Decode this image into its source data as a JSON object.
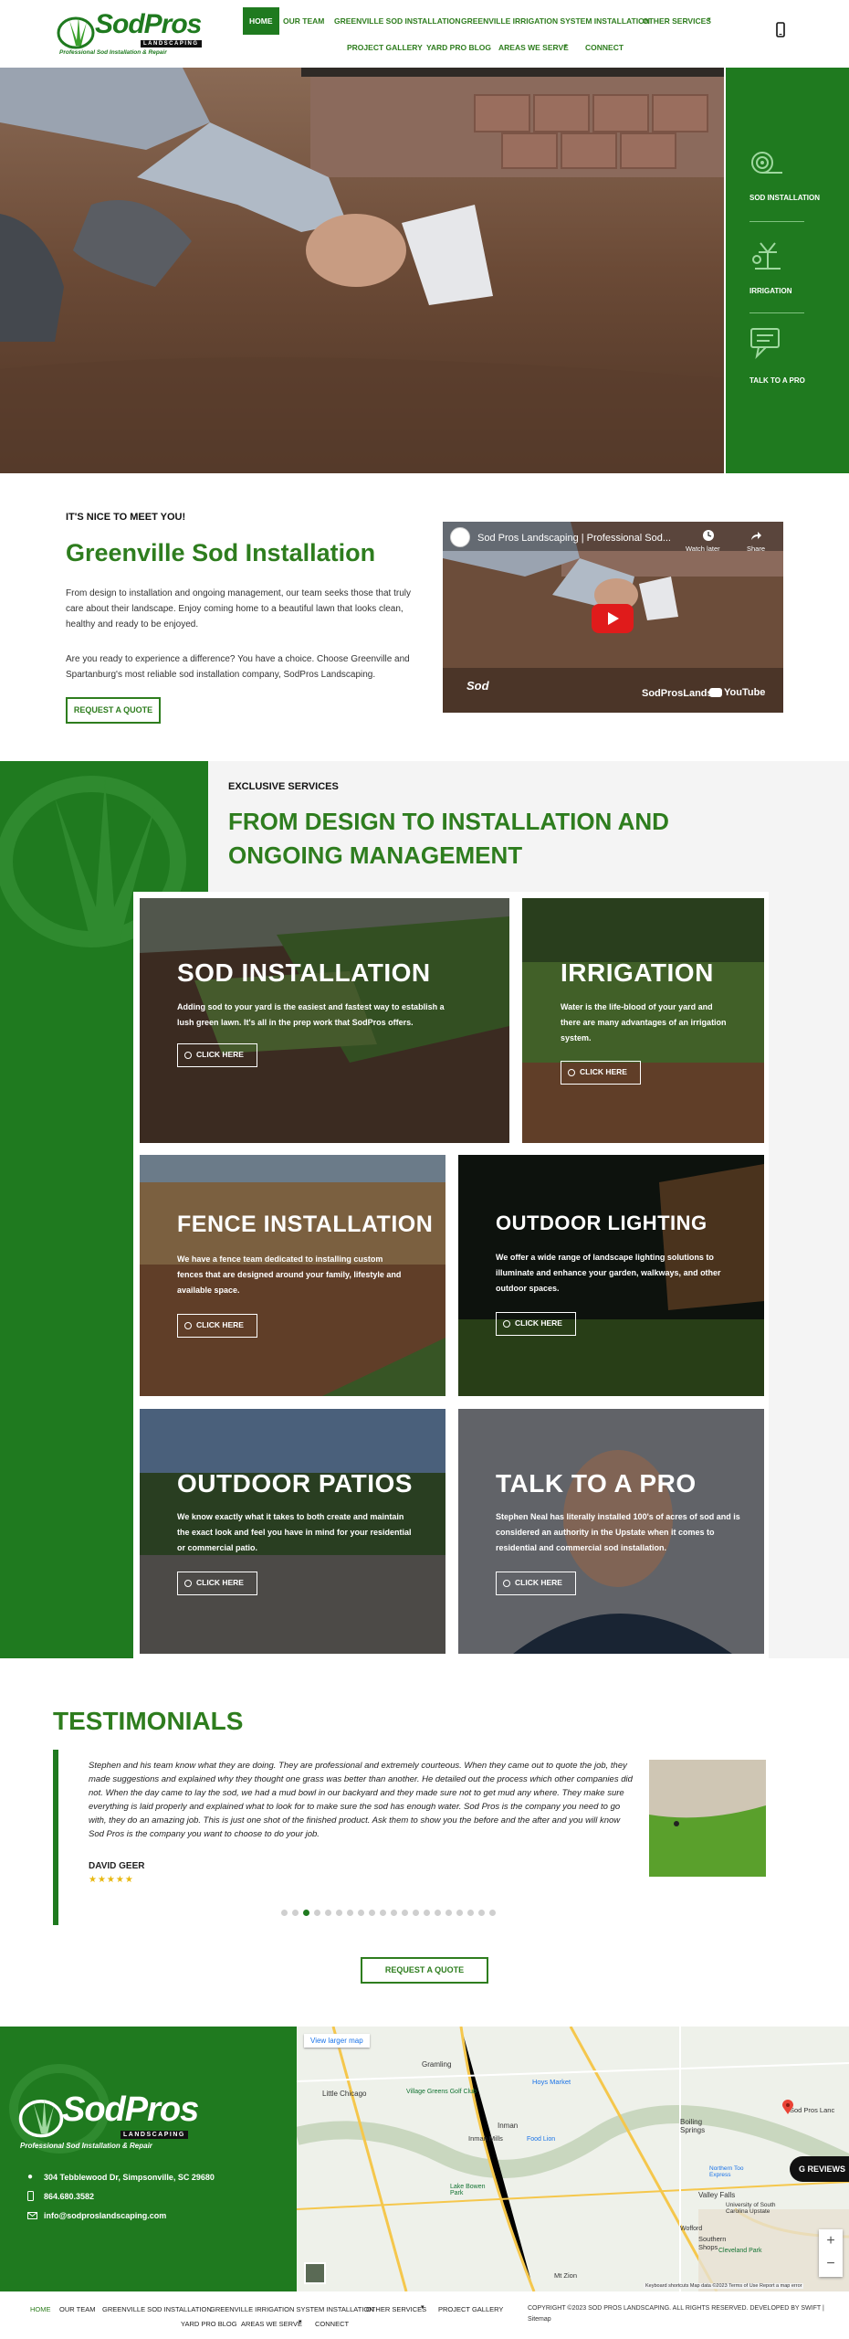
{
  "header": {
    "logo_main": "SodPros",
    "logo_sub": "LANDSCAPING",
    "logo_tagline": "Professional Sod Installation & Repair",
    "nav": [
      "HOME",
      "OUR TEAM",
      "GREENVILLE SOD INSTALLATION",
      "GREENVILLE IRRIGATION SYSTEM INSTALLATION",
      "OTHER SERVICES",
      "PROJECT GALLERY",
      "YARD PRO BLOG",
      "AREAS WE SERVE",
      "CONNECT"
    ],
    "phone_icon": "phone-icon"
  },
  "side_panel": {
    "items": [
      {
        "label": "SOD INSTALLATION",
        "icon": "sod-roll-icon"
      },
      {
        "label": "IRRIGATION",
        "icon": "sprinkler-icon"
      },
      {
        "label": "TALK TO A PRO",
        "icon": "chat-icon"
      }
    ]
  },
  "intro": {
    "eyebrow": "IT'S NICE TO MEET YOU!",
    "title": "Greenville Sod Installation",
    "p1": "From design to installation and ongoing management, our team seeks those that truly care about their landscape. Enjoy coming home to a beautiful lawn that looks clean, healthy and ready to be enjoyed.",
    "p2": "Are you ready to experience a difference? You have a choice. Choose Greenville and Spartanburg's most reliable sod installation company, SodPros Landscaping.",
    "button": "REQUEST A QUOTE",
    "video": {
      "title": "Sod Pros Landscaping | Professional Sod...",
      "watch_later": "Watch later",
      "share": "Share",
      "overlay_brand": "Sod",
      "overlay_channel": "SodProsLands",
      "youtube": "YouTube"
    }
  },
  "services": {
    "eyebrow": "EXCLUSIVE SERVICES",
    "title_line1": "FROM DESIGN TO INSTALLATION AND",
    "title_line2": "ONGOING MANAGEMENT",
    "cards": [
      {
        "title": "SOD INSTALLATION",
        "desc": "Adding sod to your yard is the easiest and fastest way to establish a lush green lawn. It's all in the prep work that SodPros offers.",
        "button": "CLICK HERE"
      },
      {
        "title": "IRRIGATION",
        "desc": "Water is the life-blood of your yard and there are many advantages of an irrigation system.",
        "button": "CLICK HERE"
      },
      {
        "title": "FENCE INSTALLATION",
        "desc": "We have a fence team dedicated to installing custom fences that are designed around your family, lifestyle and available space.",
        "button": "CLICK HERE"
      },
      {
        "title": "OUTDOOR LIGHTING",
        "desc": "We offer a wide range of landscape lighting solutions to illuminate and enhance your garden, walkways, and other outdoor spaces.",
        "button": "CLICK HERE"
      },
      {
        "title": "OUTDOOR PATIOS",
        "desc": "We know exactly what it takes to both create and maintain the exact look and feel you have in mind for your residential or commercial patio.",
        "button": "CLICK HERE"
      },
      {
        "title": "TALK TO A PRO",
        "desc": "Stephen Neal has literally installed 100's of acres of sod and is considered an authority in the Upstate when it comes to residential and commercial sod installation.",
        "button": "CLICK HERE"
      }
    ]
  },
  "testimonials": {
    "title": "TESTIMONIALS",
    "quote": "Stephen and his team know what they are doing. They are professional and extremely courteous. When they came out to quote the job, they made suggestions and explained why they thought one grass was better than another. He detailed out the process which other companies did not. When the day came to lay the sod, we had a mud bowl in our backyard and they made sure not to get mud any where. They make sure everything is laid properly and explained what to look for to make sure the sod has enough water. Sod Pros is the company you need to go with, they do an amazing job. This is just one shot of the finished product. Ask them to show you the before and the after and you will know Sod Pros is the company you want to choose to do your job.",
    "author": "DAVID GEER",
    "stars": "★★★★★",
    "rating": 5,
    "dots_total": 20,
    "dot_active": 3,
    "button": "REQUEST A QUOTE"
  },
  "footer": {
    "logo_main": "SodPros",
    "logo_sub": "LANDSCAPING",
    "logo_tagline": "Professional Sod Installation & Repair",
    "address": "304 Tebblewood Dr, Simpsonville, SC 29680",
    "phone": "864.680.3582",
    "email": "info@sodproslandscaping.com",
    "map": {
      "larger": "View larger map",
      "places": [
        "Gramling",
        "Little Chicago",
        "Village Greens Golf Club",
        "Hoys Market",
        "Inman",
        "Inman Mills",
        "Food Lion",
        "Boiling Springs",
        "Sod Pros Lanc",
        "Valley Falls",
        "University of South Carolina Upstate",
        "Northern Too Express",
        "Lake Bowen Park",
        "Cleveland Park",
        "Southern Shops",
        "Mt Zion",
        "Wofford"
      ],
      "reviews": "REVIEWS",
      "attribution": "Keyboard shortcuts   Map data ©2023   Terms of Use   Report a map error"
    },
    "bottom_nav": [
      "HOME",
      "OUR TEAM",
      "GREENVILLE SOD INSTALLATION",
      "GREENVILLE IRRIGATION SYSTEM INSTALLATION",
      "OTHER SERVICES",
      "PROJECT GALLERY",
      "YARD PRO BLOG",
      "AREAS WE SERVE",
      "CONNECT"
    ],
    "copyright_line1": "COPYRIGHT ©2023 SOD PROS LANDSCAPING. ALL RIGHTS RESERVED. DEVELOPED BY SWIFT |",
    "copyright_line2": "Sitemap"
  },
  "colors": {
    "brand_green": "#1f7a1f",
    "text_green": "#2e7d1e",
    "soil": "#6b4a35"
  }
}
